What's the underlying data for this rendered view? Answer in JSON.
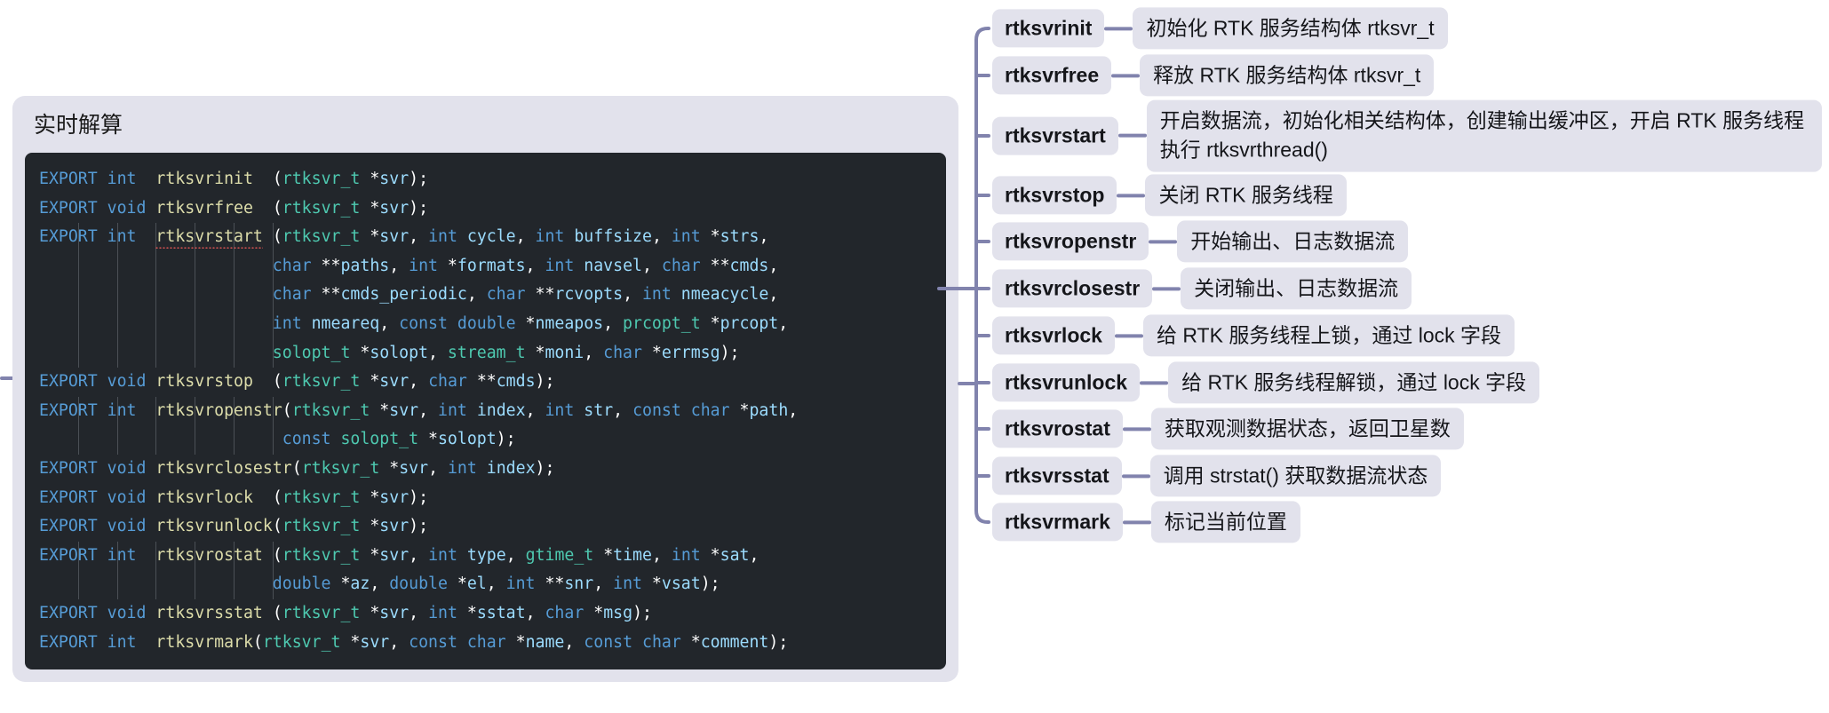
{
  "card": {
    "title": "实时解算",
    "code_lines": [
      "EXPORT int  rtksvrinit  (rtksvr_t *svr);",
      "EXPORT void rtksvrfree  (rtksvr_t *svr);",
      "EXPORT int  rtksvrstart (rtksvr_t *svr, int cycle, int buffsize, int *strs,",
      "                        char **paths, int *formats, int navsel, char **cmds,",
      "                        char **cmds_periodic, char **rcvopts, int nmeacycle,",
      "                        int nmeareq, const double *nmeapos, prcopt_t *prcopt,",
      "                        solopt_t *solopt, stream_t *moni, char *errmsg);",
      "EXPORT void rtksvrstop  (rtksvr_t *svr, char **cmds);",
      "EXPORT int  rtksvropenstr(rtksvr_t *svr, int index, int str, const char *path,",
      "                         const solopt_t *solopt);",
      "EXPORT void rtksvrclosestr(rtksvr_t *svr, int index);",
      "EXPORT void rtksvrlock  (rtksvr_t *svr);",
      "EXPORT void rtksvrunlock(rtksvr_t *svr);",
      "EXPORT int  rtksvrostat (rtksvr_t *svr, int type, gtime_t *time, int *sat,",
      "                        double *az, double *el, int **snr, int *vsat);",
      "EXPORT void rtksvrsstat (rtksvr_t *svr, int *sstat, char *msg);",
      "EXPORT int  rtksvrmark(rtksvr_t *svr, const char *name, const char *comment);"
    ]
  },
  "colors": {
    "node_bg": "#e2e2ec",
    "connector": "#8183ad",
    "code_bg": "#22262b",
    "keyword": "#569cd6",
    "type": "#4ec9b0",
    "function": "#dcdcaa",
    "param": "#9cdcfe",
    "text": "#15161a"
  },
  "mindmap": {
    "nodes": [
      {
        "name": "rtksvrinit",
        "desc": "初始化 RTK 服务结构体 rtksvr_t"
      },
      {
        "name": "rtksvrfree",
        "desc": "释放 RTK 服务结构体 rtksvr_t"
      },
      {
        "name": "rtksvrstart",
        "desc": "开启数据流，初始化相关结构体，创建输出缓冲区，开启 RTK 服务线程执行 rtksvrthread()"
      },
      {
        "name": "rtksvrstop",
        "desc": "关闭 RTK 服务线程"
      },
      {
        "name": "rtksvropenstr",
        "desc": "开始输出、日志数据流"
      },
      {
        "name": "rtksvrclosestr",
        "desc": "关闭输出、日志数据流"
      },
      {
        "name": "rtksvrlock",
        "desc": "给 RTK 服务线程上锁，通过 lock 字段"
      },
      {
        "name": "rtksvrunlock",
        "desc": "给 RTK 服务线程解锁，通过 lock 字段"
      },
      {
        "name": "rtksvrostat",
        "desc": "获取观测数据状态，返回卫星数"
      },
      {
        "name": "rtksvrsstat",
        "desc": "调用 strstat() 获取数据流状态"
      },
      {
        "name": "rtksvrmark",
        "desc": "标记当前位置"
      }
    ]
  }
}
